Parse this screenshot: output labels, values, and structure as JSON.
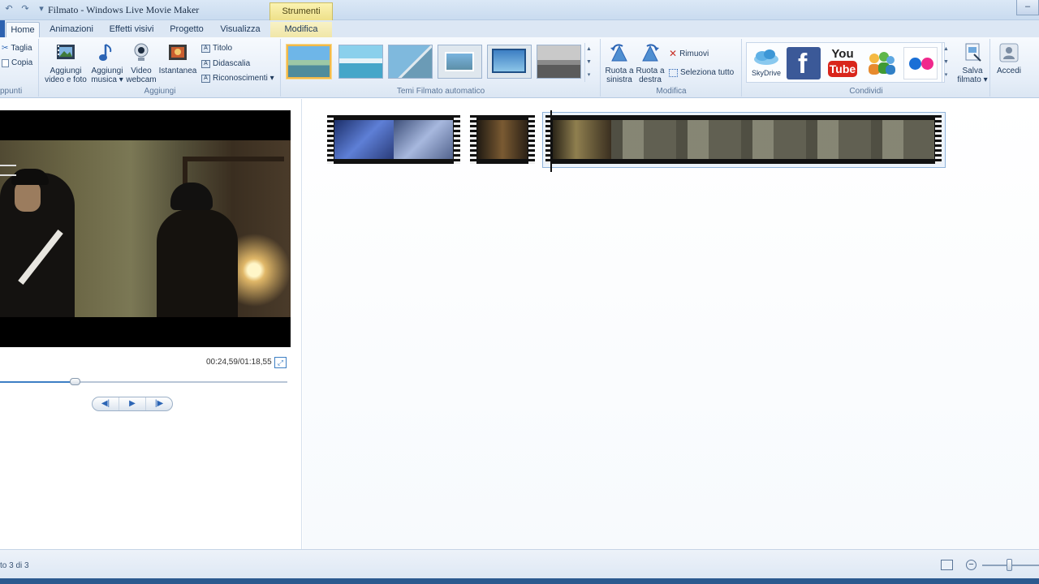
{
  "window": {
    "title": "Filmato - Windows Live Movie Maker",
    "context_tab_group": "Strumenti video",
    "controls": {
      "minimize": "–",
      "maximize": "□",
      "close": "✕"
    }
  },
  "quick_access": {
    "undo": "↶",
    "redo": "↷",
    "menu": "▾"
  },
  "tabs": [
    {
      "label": "Home",
      "active": true
    },
    {
      "label": "Animazioni"
    },
    {
      "label": "Effetti visivi"
    },
    {
      "label": "Progetto"
    },
    {
      "label": "Visualizza"
    },
    {
      "label": "Modifica",
      "contextual": true
    }
  ],
  "ribbon": {
    "appunti": {
      "label": "ppunti",
      "taglia": "Taglia",
      "copia": "Copia"
    },
    "aggiungi": {
      "label": "Aggiungi",
      "add_video": "Aggiungi video e foto",
      "add_video_l1": "Aggiungi",
      "add_video_l2": "video e foto",
      "add_music_l1": "Aggiungi",
      "add_music_l2": "musica ▾",
      "webcam_l1": "Video",
      "webcam_l2": "webcam",
      "snapshot": "Istantanea",
      "title": "Titolo",
      "caption": "Didascalia",
      "credits": "Riconoscimenti ▾"
    },
    "temi": {
      "label": "Temi Filmato automatico",
      "themes": [
        "theme-1",
        "theme-2",
        "theme-3",
        "theme-4",
        "theme-5",
        "theme-6"
      ],
      "selected": 0,
      "scroll_up": "▲",
      "scroll_down": "▼",
      "more": "▾"
    },
    "modifica": {
      "label": "Modifica",
      "rotate_left_l1": "Ruota a",
      "rotate_left_l2": "sinistra",
      "rotate_right_l1": "Ruota a",
      "rotate_right_l2": "destra",
      "remove": "Rimuovi",
      "select_all": "Seleziona tutto"
    },
    "condividi": {
      "label": "Condividi",
      "skydrive": "SkyDrive",
      "facebook_glyph": "f",
      "youtube_l1": "You",
      "youtube_l2": "Tube",
      "save_l1": "Salva",
      "save_l2": "filmato ▾"
    },
    "accedi": {
      "label": "Accedi"
    }
  },
  "preview": {
    "time": "00:24,59/01:18,55",
    "progress": 0.26,
    "fullscreen_glyph": "⤢",
    "prev_glyph": "◀|",
    "play_glyph": "▶",
    "next_glyph": "|▶"
  },
  "storyboard": {
    "clips": [
      {
        "name": "clip-1",
        "selected": false
      },
      {
        "name": "clip-2",
        "selected": false
      },
      {
        "name": "clip-3",
        "selected": true
      }
    ]
  },
  "status": {
    "text": "to 3 di 3"
  },
  "colors": {
    "accent": "#3d7fc4",
    "ribbon_bg": "#e6eef8",
    "context_tab": "#eee089"
  }
}
